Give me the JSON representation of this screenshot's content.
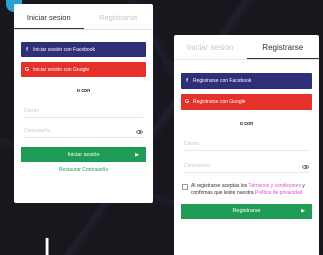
{
  "colors": {
    "facebook": "#2f2e78",
    "google": "#e4322b",
    "submit": "#1f9c55",
    "link": "#e14bd2",
    "background": "#17171d"
  },
  "login_card": {
    "tabs": [
      "Iniciar sesion",
      "Registrarse"
    ],
    "active_tab": 0,
    "facebook_icon": "f",
    "facebook_label": "Iniciar sesión con Facebook",
    "google_icon": "G",
    "google_label": "Iniciar sesión con Google",
    "divider": "o con",
    "email_placeholder": "Correo",
    "password_placeholder": "Contraseña",
    "submit_label": "Iniciar sesión",
    "submit_icon": "▶",
    "forgot_label": "Restaurar Contraseña"
  },
  "register_card": {
    "tabs": [
      "Iniciar sesion",
      "Registrarse"
    ],
    "active_tab": 1,
    "facebook_icon": "f",
    "facebook_label": "Registrarse con Facebook",
    "google_icon": "G",
    "google_label": "Registrarse con Google",
    "divider": "o con",
    "email_placeholder": "Correo",
    "password_placeholder": "Contraseña",
    "terms_prefix": "Al registrarse aceptas los ",
    "terms_link": "Términos y condiciones",
    "terms_middle": " y confirmas que leiste nuestra ",
    "privacy_link": "Política de privacidad",
    "submit_label": "Registrarse",
    "submit_icon": "▶"
  },
  "icons": {
    "eye": "eye-icon",
    "arrow": "play-arrow-icon"
  }
}
